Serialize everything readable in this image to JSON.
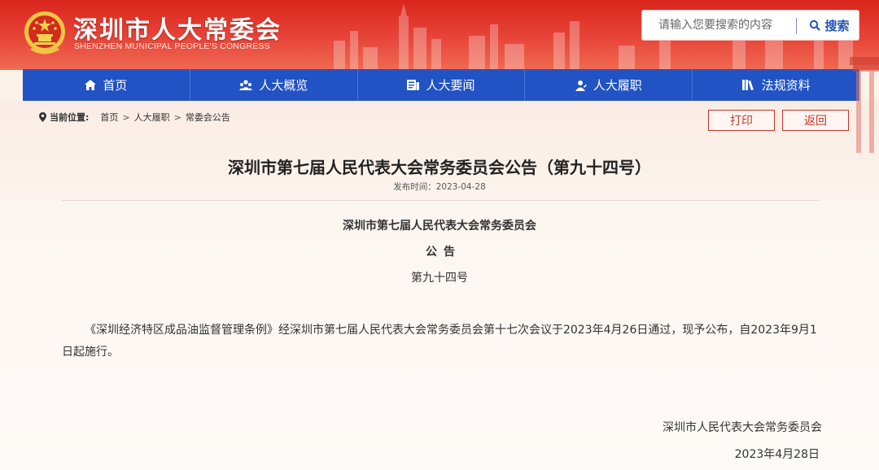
{
  "header": {
    "site_title": "深圳市人大常委会",
    "site_subtitle": "SHENZHEN MUNICIPAL PEOPLE'S CONGRESS",
    "search": {
      "placeholder": "请输入您要搜索的内容",
      "button_label": "搜索"
    }
  },
  "nav": {
    "items": [
      {
        "label": "首页",
        "icon": "home-icon"
      },
      {
        "label": "人大概览",
        "icon": "people-icon"
      },
      {
        "label": "人大要闻",
        "icon": "news-icon"
      },
      {
        "label": "人大履职",
        "icon": "duty-icon"
      },
      {
        "label": "法规资料",
        "icon": "books-icon"
      }
    ]
  },
  "breadcrumb": {
    "label": "当前位置:",
    "items": [
      "首页",
      "人大履职",
      "常委会公告"
    ],
    "separator": ">"
  },
  "actions": {
    "print_label": "打印",
    "back_label": "返回"
  },
  "article": {
    "title": "深圳市第七届人民代表大会常务委员会公告（第九十四号）",
    "publish_date": "发布时间：2023-04-28",
    "org_heading": "深圳市第七届人民代表大会常务委员会",
    "notice_label": "公告",
    "notice_number": "第九十四号",
    "body": "《深圳经济特区成品油监督管理条例》经深圳市第七届人民代表大会常务委员会第十七次会议于2023年4月26日通过，现予公布，自2023年9月1日起施行。",
    "signature_org": "深圳市人民代表大会常务委员会",
    "signature_date": "2023年4月28日"
  },
  "colors": {
    "header_red": "#d9261c",
    "nav_blue": "#2253c4",
    "button_red": "#c0392b",
    "search_blue": "#2353b6"
  }
}
